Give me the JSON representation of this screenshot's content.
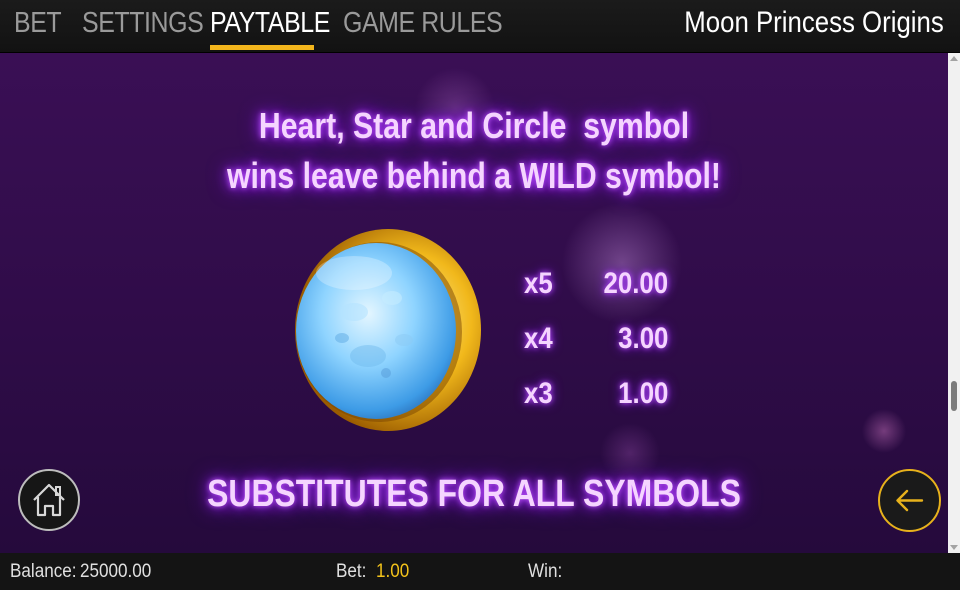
{
  "nav": {
    "tabs": [
      {
        "label": "BET",
        "active": false
      },
      {
        "label": "SETTINGS",
        "active": false
      },
      {
        "label": "PAYTABLE",
        "active": true
      },
      {
        "label": "GAME RULES",
        "active": false
      }
    ],
    "game_title": "Moon Princess Origins",
    "accent_color": "#f2b51c"
  },
  "paytable": {
    "headline_line1": "Heart, Star and Circle  symbol",
    "headline_line2": "wins leave behind a WILD symbol!",
    "symbol_icon": "moon-orb-icon",
    "payouts": [
      {
        "multiplier": "x5",
        "value": "20.00"
      },
      {
        "multiplier": "x4",
        "value": "3.00"
      },
      {
        "multiplier": "x3",
        "value": "1.00"
      }
    ],
    "note": "SUBSTITUTES FOR ALL SYMBOLS"
  },
  "controls": {
    "home_icon": "home-icon",
    "back_icon": "arrow-left-icon"
  },
  "footer": {
    "balance_label": "Balance:",
    "balance_value": "25000.00",
    "bet_label": "Bet:",
    "bet_value": "1.00",
    "win_label": "Win:",
    "win_value": ""
  }
}
